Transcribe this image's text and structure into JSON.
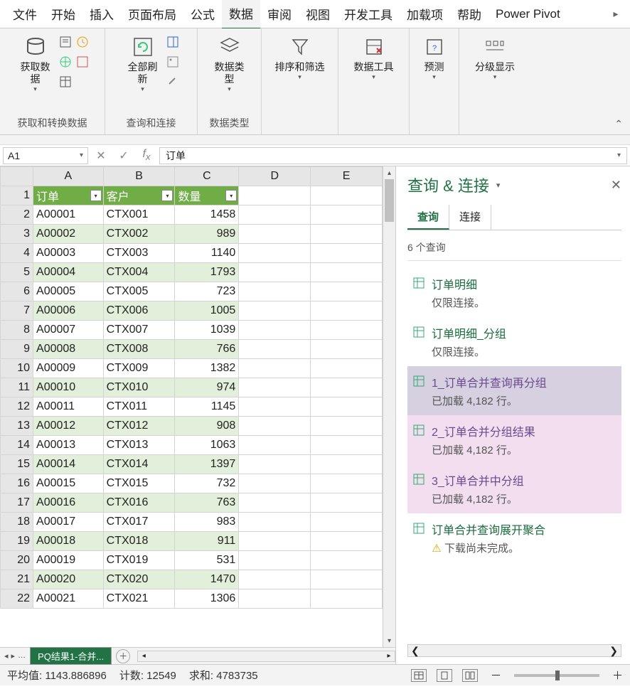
{
  "ribbon": {
    "tabs": [
      "文件",
      "开始",
      "插入",
      "页面布局",
      "公式",
      "数据",
      "审阅",
      "视图",
      "开发工具",
      "加载项",
      "帮助",
      "Power Pivot"
    ],
    "active_index": 5,
    "groups": {
      "get_transform": {
        "label": "获取和转换数据",
        "btn": "获取数\n据"
      },
      "queries_conn": {
        "label": "查询和连接",
        "btn": "全部刷新"
      },
      "data_types": {
        "label": "数据类型",
        "btn": "数据类\n型"
      },
      "sort_filter": {
        "label": "",
        "btn": "排序和筛选"
      },
      "data_tools": {
        "label": "",
        "btn": "数据工具"
      },
      "forecast": {
        "label": "",
        "btn": "预测"
      },
      "outline": {
        "label": "",
        "btn": "分级显示"
      }
    }
  },
  "name_box": "A1",
  "formula_value": "订单",
  "columns": [
    "A",
    "B",
    "C",
    "D",
    "E"
  ],
  "headers": [
    "订单",
    "客户",
    "数量"
  ],
  "rows": [
    {
      "n": 1
    },
    {
      "n": 2,
      "a": "A00001",
      "b": "CTX001",
      "c": 1458
    },
    {
      "n": 3,
      "a": "A00002",
      "b": "CTX002",
      "c": 989
    },
    {
      "n": 4,
      "a": "A00003",
      "b": "CTX003",
      "c": 1140
    },
    {
      "n": 5,
      "a": "A00004",
      "b": "CTX004",
      "c": 1793
    },
    {
      "n": 6,
      "a": "A00005",
      "b": "CTX005",
      "c": 723
    },
    {
      "n": 7,
      "a": "A00006",
      "b": "CTX006",
      "c": 1005
    },
    {
      "n": 8,
      "a": "A00007",
      "b": "CTX007",
      "c": 1039
    },
    {
      "n": 9,
      "a": "A00008",
      "b": "CTX008",
      "c": 766
    },
    {
      "n": 10,
      "a": "A00009",
      "b": "CTX009",
      "c": 1382
    },
    {
      "n": 11,
      "a": "A00010",
      "b": "CTX010",
      "c": 974
    },
    {
      "n": 12,
      "a": "A00011",
      "b": "CTX011",
      "c": 1145
    },
    {
      "n": 13,
      "a": "A00012",
      "b": "CTX012",
      "c": 908
    },
    {
      "n": 14,
      "a": "A00013",
      "b": "CTX013",
      "c": 1063
    },
    {
      "n": 15,
      "a": "A00014",
      "b": "CTX014",
      "c": 1397
    },
    {
      "n": 16,
      "a": "A00015",
      "b": "CTX015",
      "c": 732
    },
    {
      "n": 17,
      "a": "A00016",
      "b": "CTX016",
      "c": 763
    },
    {
      "n": 18,
      "a": "A00017",
      "b": "CTX017",
      "c": 983
    },
    {
      "n": 19,
      "a": "A00018",
      "b": "CTX018",
      "c": 911
    },
    {
      "n": 20,
      "a": "A00019",
      "b": "CTX019",
      "c": 531
    },
    {
      "n": 21,
      "a": "A00020",
      "b": "CTX020",
      "c": 1470
    },
    {
      "n": 22,
      "a": "A00021",
      "b": "CTX021",
      "c": 1306
    }
  ],
  "sheet_tab": "PQ结果1-合并...",
  "pane": {
    "title": "查询 & 连接",
    "tabs": [
      "查询",
      "连接"
    ],
    "count": "6 个查询",
    "queries": [
      {
        "name": "订单明细",
        "status": "仅限连接。",
        "variant": "plain"
      },
      {
        "name": "订单明细_分组",
        "status": "仅限连接。",
        "variant": "plain"
      },
      {
        "name": "1_订单合并查询再分组",
        "status": "已加载 4,182 行。",
        "variant": "sel"
      },
      {
        "name": "2_订单合并分组结果",
        "status": "已加载 4,182 行。",
        "variant": "pink"
      },
      {
        "name": "3_订单合并中分组",
        "status": "已加载 4,182 行。",
        "variant": "pink"
      },
      {
        "name": "订单合并查询展开聚合",
        "status": "下载尚未完成。",
        "variant": "warn"
      }
    ]
  },
  "status": {
    "avg_label": "平均值:",
    "avg": "1143.886896",
    "count_label": "计数:",
    "count": "12549",
    "sum_label": "求和:",
    "sum": "4783735"
  }
}
